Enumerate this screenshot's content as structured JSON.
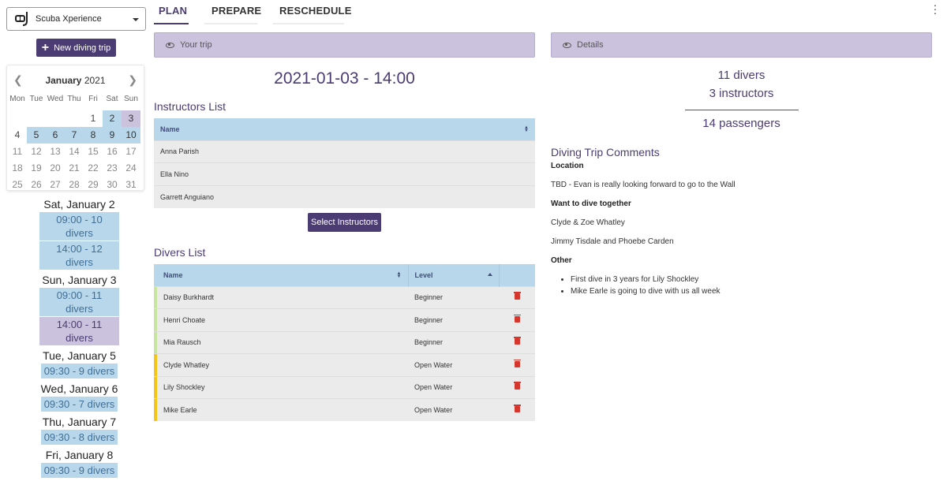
{
  "sidebar": {
    "org_name": "Scuba Xperience",
    "new_trip_label": "New diving trip",
    "calendar": {
      "month": "January",
      "year": "2021",
      "weekdays": [
        "Mon",
        "Tue",
        "Wed",
        "Thu",
        "Fri",
        "Sat",
        "Sun"
      ],
      "weeks": [
        [
          {
            "d": "",
            "s": ""
          },
          {
            "d": "",
            "s": ""
          },
          {
            "d": "",
            "s": ""
          },
          {
            "d": "",
            "s": ""
          },
          {
            "d": "1",
            "s": "inmonth"
          },
          {
            "d": "2",
            "s": "avail"
          },
          {
            "d": "3",
            "s": "sel"
          }
        ],
        [
          {
            "d": "4",
            "s": "inmonth"
          },
          {
            "d": "5",
            "s": "avail"
          },
          {
            "d": "6",
            "s": "avail"
          },
          {
            "d": "7",
            "s": "avail"
          },
          {
            "d": "8",
            "s": "avail"
          },
          {
            "d": "9",
            "s": "avail"
          },
          {
            "d": "10",
            "s": "avail"
          }
        ],
        [
          {
            "d": "11",
            "s": ""
          },
          {
            "d": "12",
            "s": ""
          },
          {
            "d": "13",
            "s": ""
          },
          {
            "d": "14",
            "s": ""
          },
          {
            "d": "15",
            "s": ""
          },
          {
            "d": "16",
            "s": ""
          },
          {
            "d": "17",
            "s": ""
          }
        ],
        [
          {
            "d": "18",
            "s": ""
          },
          {
            "d": "19",
            "s": ""
          },
          {
            "d": "20",
            "s": ""
          },
          {
            "d": "21",
            "s": ""
          },
          {
            "d": "22",
            "s": ""
          },
          {
            "d": "23",
            "s": ""
          },
          {
            "d": "24",
            "s": ""
          }
        ],
        [
          {
            "d": "25",
            "s": ""
          },
          {
            "d": "26",
            "s": ""
          },
          {
            "d": "27",
            "s": ""
          },
          {
            "d": "28",
            "s": ""
          },
          {
            "d": "29",
            "s": ""
          },
          {
            "d": "30",
            "s": ""
          },
          {
            "d": "31",
            "s": ""
          }
        ]
      ]
    },
    "days": [
      {
        "title": "Sat, January 2",
        "slots": [
          {
            "label": "09:00 - 10 divers",
            "color": "blue"
          },
          {
            "label": "14:00 - 12 divers",
            "color": "blue"
          }
        ]
      },
      {
        "title": "Sun, January 3",
        "slots": [
          {
            "label": "09:00 - 11 divers",
            "color": "blue"
          },
          {
            "label": "14:00 - 11 divers",
            "color": "purple"
          }
        ]
      },
      {
        "title": "Tue, January 5",
        "slots": [
          {
            "label": "09:30 - 9 divers",
            "color": "blue"
          }
        ]
      },
      {
        "title": "Wed, January 6",
        "slots": [
          {
            "label": "09:30 - 7 divers",
            "color": "blue"
          }
        ]
      },
      {
        "title": "Thu, January 7",
        "slots": [
          {
            "label": "09:30 - 8 divers",
            "color": "blue"
          }
        ]
      },
      {
        "title": "Fri, January 8",
        "slots": [
          {
            "label": "09:30 - 9 divers",
            "color": "blue"
          }
        ]
      }
    ]
  },
  "tabs": {
    "plan": "PLAN",
    "prepare": "PREPARE",
    "reschedule": "RESCHEDULE"
  },
  "trip": {
    "panel_title": "Your trip",
    "datetime": "2021-01-03 - 14:00",
    "instructors_title": "Instructors List",
    "instructors_header": "Name",
    "instructors": [
      "Anna Parish",
      "Ella Nino",
      "Garrett Anguiano"
    ],
    "select_instructors_label": "Select Instructors",
    "divers_title": "Divers List",
    "divers_headers": {
      "name": "Name",
      "level": "Level"
    },
    "divers": [
      {
        "name": "Daisy Burkhardt",
        "level": "Beginner",
        "color": "#c9e6a0"
      },
      {
        "name": "Henri Choate",
        "level": "Beginner",
        "color": "#c9e6a0"
      },
      {
        "name": "Mia Rausch",
        "level": "Beginner",
        "color": "#c9e6a0"
      },
      {
        "name": "Clyde Whatley",
        "level": "Open Water",
        "color": "#f5c518"
      },
      {
        "name": "Lily Shockley",
        "level": "Open Water",
        "color": "#f5c518"
      },
      {
        "name": "Mike Earle",
        "level": "Open Water",
        "color": "#f5c518"
      }
    ]
  },
  "details": {
    "panel_title": "Details",
    "divers": "11 divers",
    "instructors": "3 instructors",
    "passengers": "14 passengers",
    "comments_title": "Diving Trip Comments",
    "location_heading": "Location",
    "location_text": "TBD - Evan is really looking forward to go to the Wall",
    "together_heading": "Want to dive together",
    "together_lines": [
      "Clyde & Zoe Whatley",
      "Jimmy Tisdale and Phoebe Carden"
    ],
    "other_heading": "Other",
    "other_items": [
      "First dive in 3 years for Lily Shockley",
      "Mike Earle is going to dive with us all week"
    ]
  },
  "colors": {
    "accent": "#4b3c73",
    "light_purple": "#cbc3dd",
    "light_blue": "#b9d7ea",
    "delete": "#d6362b"
  }
}
